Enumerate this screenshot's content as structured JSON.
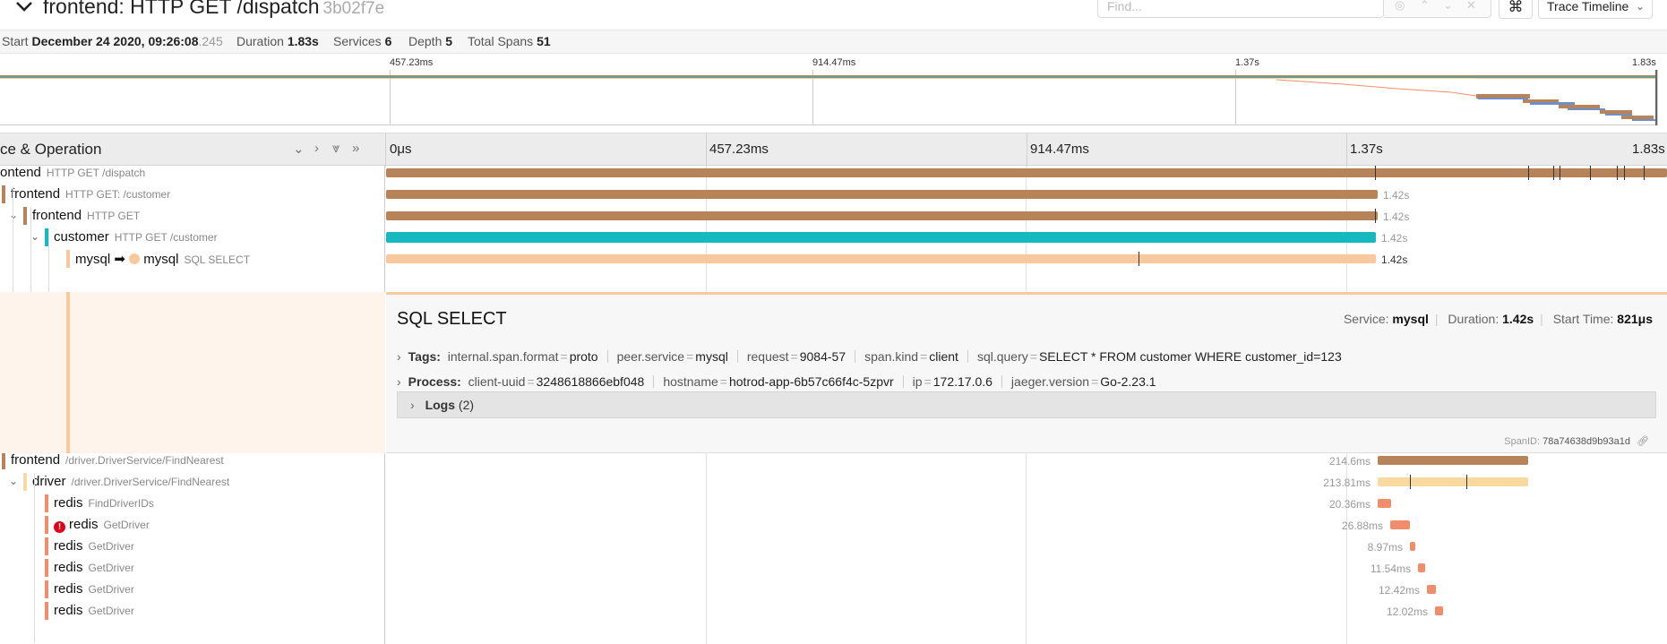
{
  "header": {
    "title": "frontend: HTTP GET /dispatch",
    "trace_id": "3b02f7e",
    "find_placeholder": "Find...",
    "keyboard_icon": "⌘",
    "view_select": "Trace Timeline"
  },
  "summary": {
    "start_label": "Start",
    "start_value": "December 24 2020, 09:26:08",
    "start_ms": ".245",
    "duration_label": "Duration",
    "duration_value": "1.83s",
    "services_label": "Services",
    "services_value": "6",
    "depth_label": "Depth",
    "depth_value": "5",
    "total_spans_label": "Total Spans",
    "total_spans_value": "51"
  },
  "minimap": {
    "ticks": [
      "457.23ms",
      "914.47ms",
      "1.37s",
      "1.83s"
    ]
  },
  "timeline_header": {
    "left_title": "ce & Operation",
    "ticks": [
      "0μs",
      "457.23ms",
      "914.47ms",
      "1.37s",
      "1.83s"
    ]
  },
  "colors": {
    "frontend": "#b68458",
    "customer": "#17b8be",
    "mysql": "#f9c89d",
    "driver": "#f9d9a0",
    "redis": "#f08e6b",
    "error": "#e0001a"
  },
  "spans": [
    {
      "service": "ontend",
      "operation": "HTTP GET /dispatch",
      "color_key": "frontend",
      "depth": 0,
      "duration": ""
    },
    {
      "service": "frontend",
      "operation": "HTTP GET: /customer",
      "color_key": "frontend",
      "depth": 0,
      "duration": "1.42s"
    },
    {
      "service": "frontend",
      "operation": "HTTP GET",
      "color_key": "frontend",
      "depth": 1,
      "duration": "1.42s"
    },
    {
      "service": "customer",
      "operation": "HTTP GET /customer",
      "color_key": "customer",
      "depth": 2,
      "duration": "1.42s"
    },
    {
      "service": "mysql",
      "arrow": "➡",
      "target": "mysql",
      "operation": "SQL SELECT",
      "color_key": "mysql",
      "depth": 3,
      "duration": "1.42s"
    },
    {
      "service": "frontend",
      "operation": "/driver.DriverService/FindNearest",
      "color_key": "frontend",
      "depth": 0,
      "duration": "214.6ms"
    },
    {
      "service": "driver",
      "operation": "/driver.DriverService/FindNearest",
      "color_key": "driver",
      "depth": 1,
      "duration": "213.81ms"
    },
    {
      "service": "redis",
      "operation": "FindDriverIDs",
      "color_key": "redis",
      "depth": 2,
      "duration": "20.36ms"
    },
    {
      "service": "redis",
      "operation": "GetDriver",
      "color_key": "redis",
      "depth": 2,
      "duration": "26.88ms",
      "error": true
    },
    {
      "service": "redis",
      "operation": "GetDriver",
      "color_key": "redis",
      "depth": 2,
      "duration": "8.97ms"
    },
    {
      "service": "redis",
      "operation": "GetDriver",
      "color_key": "redis",
      "depth": 2,
      "duration": "11.54ms"
    },
    {
      "service": "redis",
      "operation": "GetDriver",
      "color_key": "redis",
      "depth": 2,
      "duration": "12.42ms"
    },
    {
      "service": "redis",
      "operation": "GetDriver",
      "color_key": "redis",
      "depth": 2,
      "duration": "12.02ms"
    }
  ],
  "detail": {
    "title": "SQL SELECT",
    "service_label": "Service:",
    "service_value": "mysql",
    "duration_label": "Duration:",
    "duration_value": "1.42s",
    "start_label": "Start Time:",
    "start_value": "821μs",
    "tags_label": "Tags:",
    "tags": [
      {
        "k": "internal.span.format",
        "v": "proto"
      },
      {
        "k": "peer.service",
        "v": "mysql"
      },
      {
        "k": "request",
        "v": "9084-57"
      },
      {
        "k": "span.kind",
        "v": "client"
      },
      {
        "k": "sql.query",
        "v": "SELECT * FROM customer WHERE customer_id=123"
      }
    ],
    "process_label": "Process:",
    "process": [
      {
        "k": "client-uuid",
        "v": "3248618866ebf048"
      },
      {
        "k": "hostname",
        "v": "hotrod-app-6b57c66f4c-5zpvr"
      },
      {
        "k": "ip",
        "v": "172.17.0.6"
      },
      {
        "k": "jaeger.version",
        "v": "Go-2.23.1"
      }
    ],
    "logs_label": "Logs",
    "logs_count": "(2)",
    "span_id_label": "SpanID:",
    "span_id_value": "78a74638d9b93a1d"
  }
}
